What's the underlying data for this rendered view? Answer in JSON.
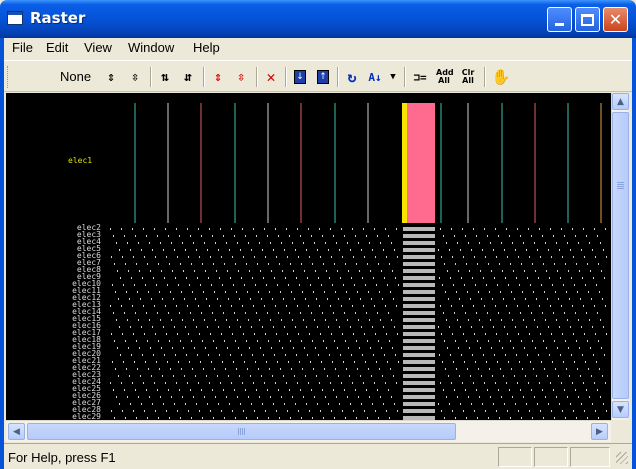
{
  "window": {
    "title": "Raster",
    "colors": {
      "titlebar": "#0553d8",
      "background": "#000000",
      "highlight_column": "#ff6b8e",
      "marker": "#f5e400"
    }
  },
  "menu": [
    "File",
    "Edit",
    "View",
    "Window",
    "Help"
  ],
  "toolbar": {
    "selection_label": "None",
    "add_all_label": "Add All",
    "clr_all_label": "Clr All",
    "icons": [
      "expand-all-icon",
      "collapse-all-icon",
      "insert-row-icon",
      "remove-row-icon",
      "move-red-up-icon",
      "move-red-down-icon",
      "delete-icon",
      "move-down-icon",
      "move-up-icon",
      "refresh-icon",
      "sort-az-icon",
      "dropdown-icon",
      "link-icon",
      "add-all-icon",
      "clr-all-icon",
      "hand-icon"
    ]
  },
  "raster": {
    "primary_channel": "elec1",
    "channels": [
      "elec2",
      "elec3",
      "elec4",
      "elec5",
      "elec6",
      "elec7",
      "elec8",
      "elec9",
      "elec10",
      "elec11",
      "elec12",
      "elec13",
      "elec14",
      "elec15",
      "elec16",
      "elec17",
      "elec18",
      "elec19",
      "elec20",
      "elec21",
      "elec22",
      "elec23",
      "elec24",
      "elec25",
      "elec26",
      "elec27",
      "elec28",
      "elec29"
    ]
  },
  "status": {
    "text": "For Help, press F1"
  }
}
